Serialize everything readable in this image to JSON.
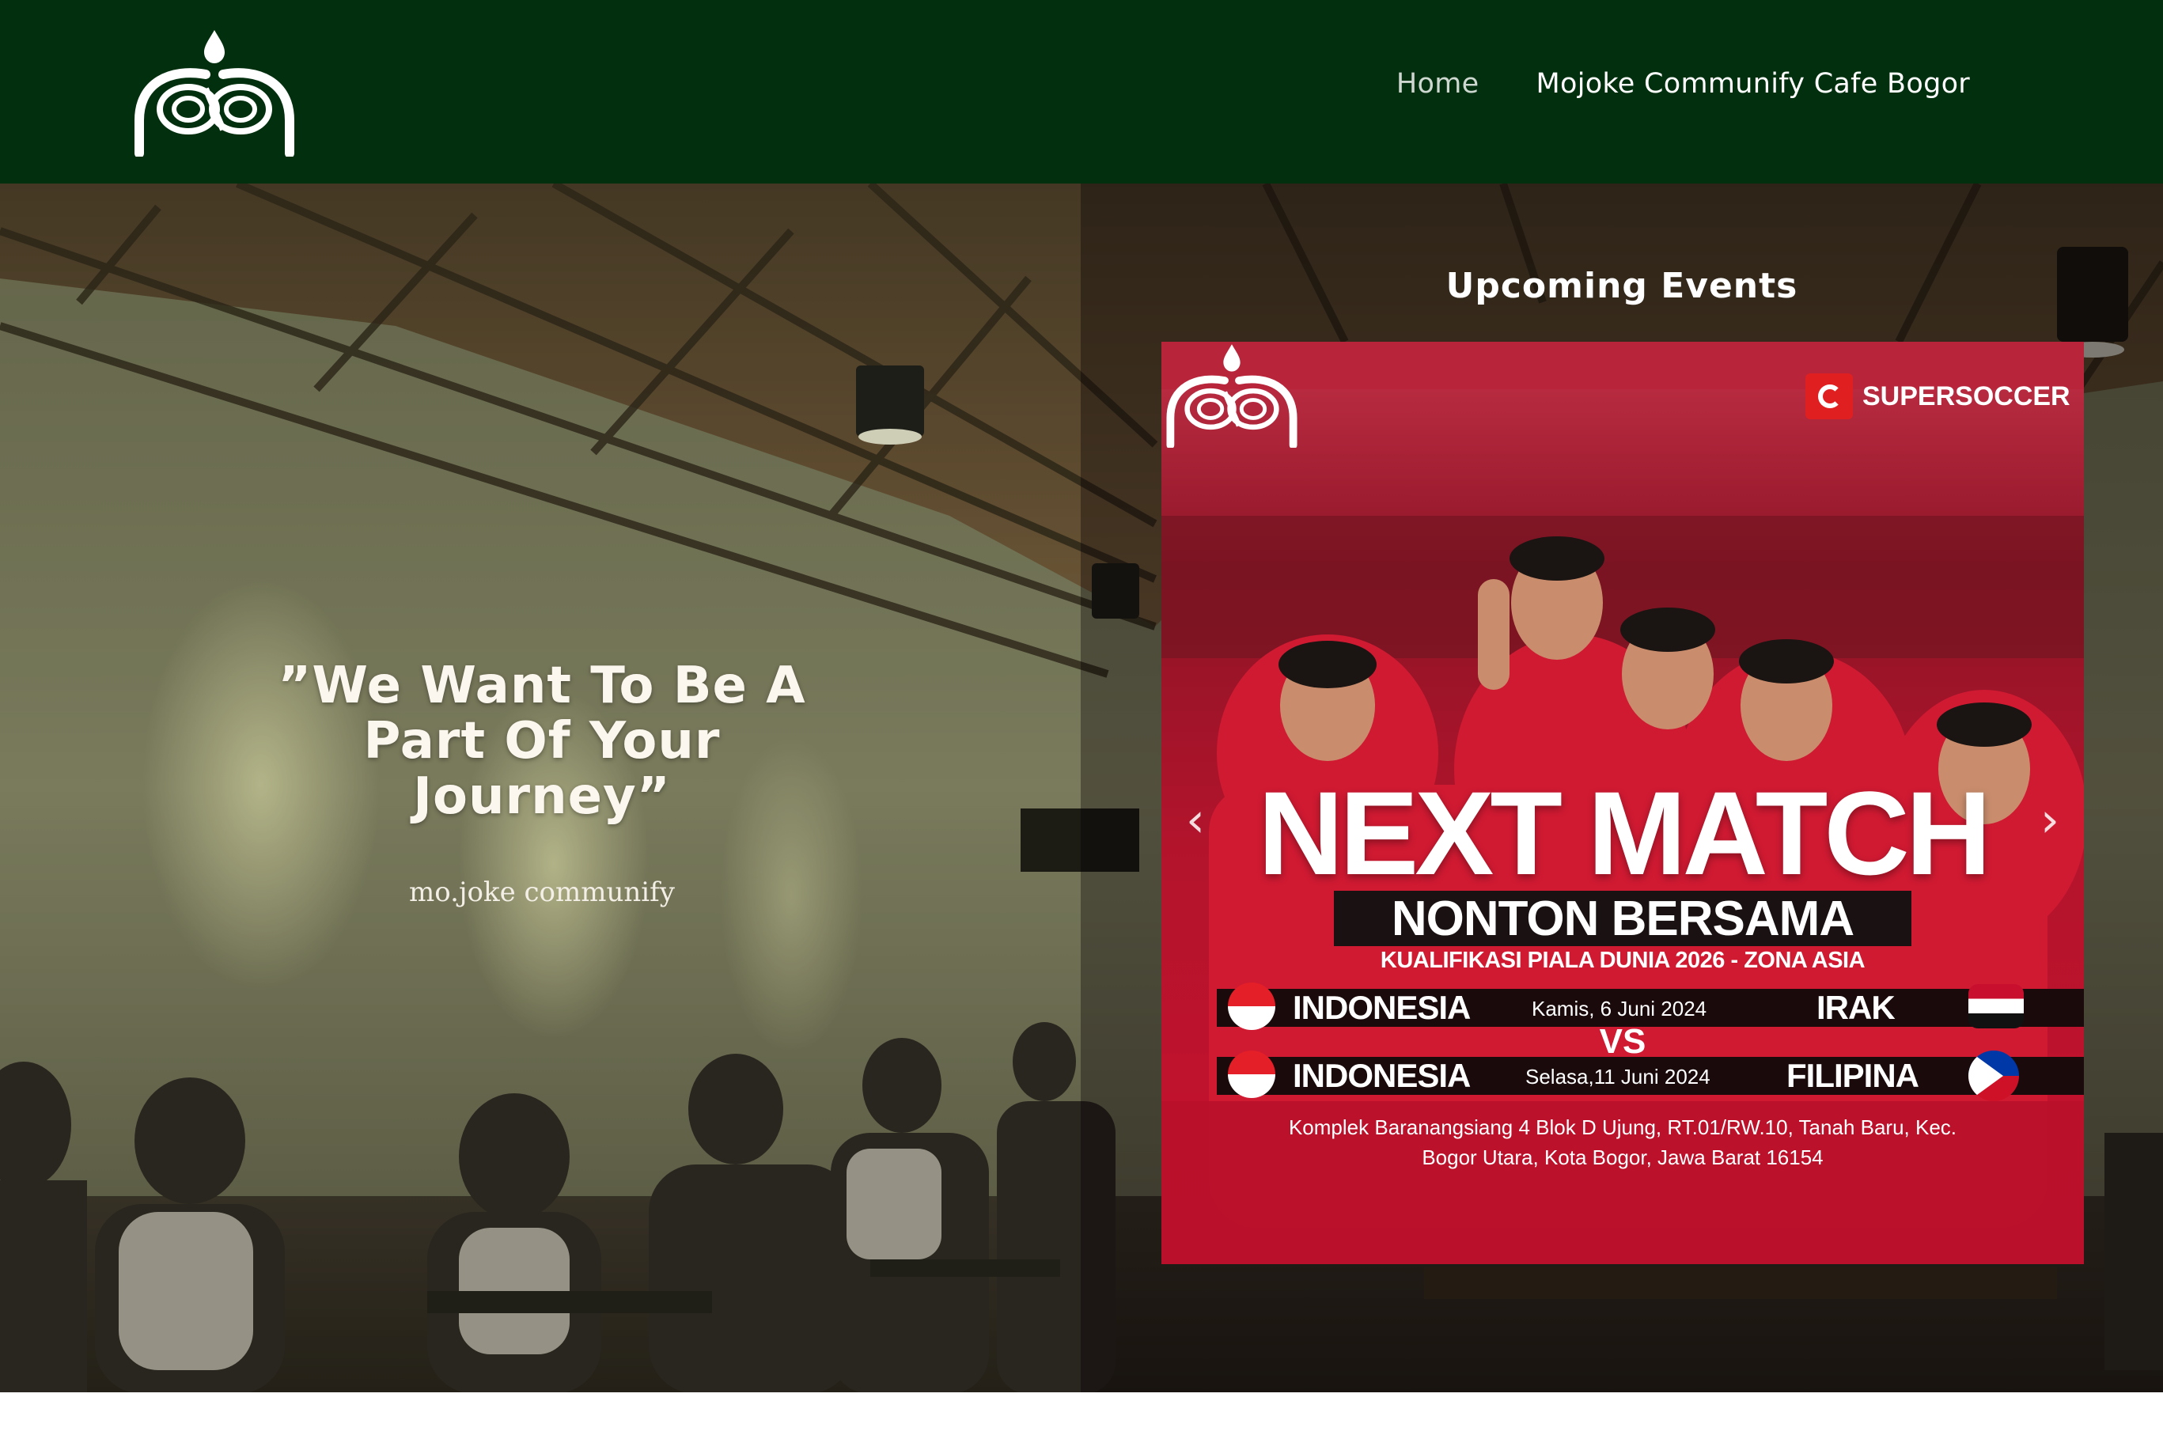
{
  "header": {
    "logo": "mojoke-logo",
    "nav": [
      {
        "label": "Home"
      },
      {
        "label": "Mojoke Communify Cafe Bogor"
      }
    ]
  },
  "hero": {
    "quote": "”We Want To Be A Part Of Your Journey”",
    "tagline": "mo.joke communify",
    "events_title": "Upcoming Events"
  },
  "poster": {
    "brand": "SUPERSOCCER",
    "headline": "NEXT MATCH",
    "subheadline": "NONTON BERSAMA",
    "competition": "KUALIFIKASI PIALA DUNIA 2026 - ZONA ASIA",
    "vs": "VS",
    "matches": [
      {
        "home": "INDONESIA",
        "date": "Kamis, 6 Juni 2024",
        "away": "IRAK"
      },
      {
        "home": "INDONESIA",
        "date": "Selasa,11 Juni 2024",
        "away": "FILIPINA"
      }
    ],
    "address_line1": "Komplek Baranangsiang 4 Blok D Ujung, RT.01/RW.10, Tanah Baru, Kec.",
    "address_line2": "Bogor Utara, Kota Bogor, Jawa Barat 16154",
    "prev_icon": "chevron-left-icon",
    "next_icon": "chevron-right-icon"
  },
  "colors": {
    "header_bg": "#02300f",
    "poster_red": "#a8122a"
  }
}
